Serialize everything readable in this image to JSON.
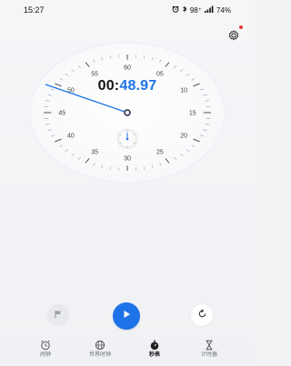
{
  "status_bar": {
    "time": "15:27",
    "indicators_text": "98⁺",
    "battery_text": "74%"
  },
  "header": {
    "settings_icon": "gear-icon"
  },
  "stopwatch": {
    "time_main": "00:",
    "time_fraction": "48.97",
    "dial_numbers": [
      "60",
      "05",
      "10",
      "15",
      "20",
      "25",
      "30",
      "35",
      "40",
      "45",
      "50",
      "55"
    ],
    "colors": {
      "accent": "#1e73e8",
      "hand": "#1e73e8"
    }
  },
  "controls": {
    "lap_icon": "flag-icon",
    "start_icon": "play-icon",
    "reset_icon": "reset-icon"
  },
  "bottom_nav": {
    "items": [
      {
        "label": "闹钟",
        "icon": "alarm-icon"
      },
      {
        "label": "世界时钟",
        "icon": "globe-icon"
      },
      {
        "label": "秒表",
        "icon": "stopwatch-icon",
        "active": true
      },
      {
        "label": "计时器",
        "icon": "hourglass-icon"
      }
    ]
  }
}
